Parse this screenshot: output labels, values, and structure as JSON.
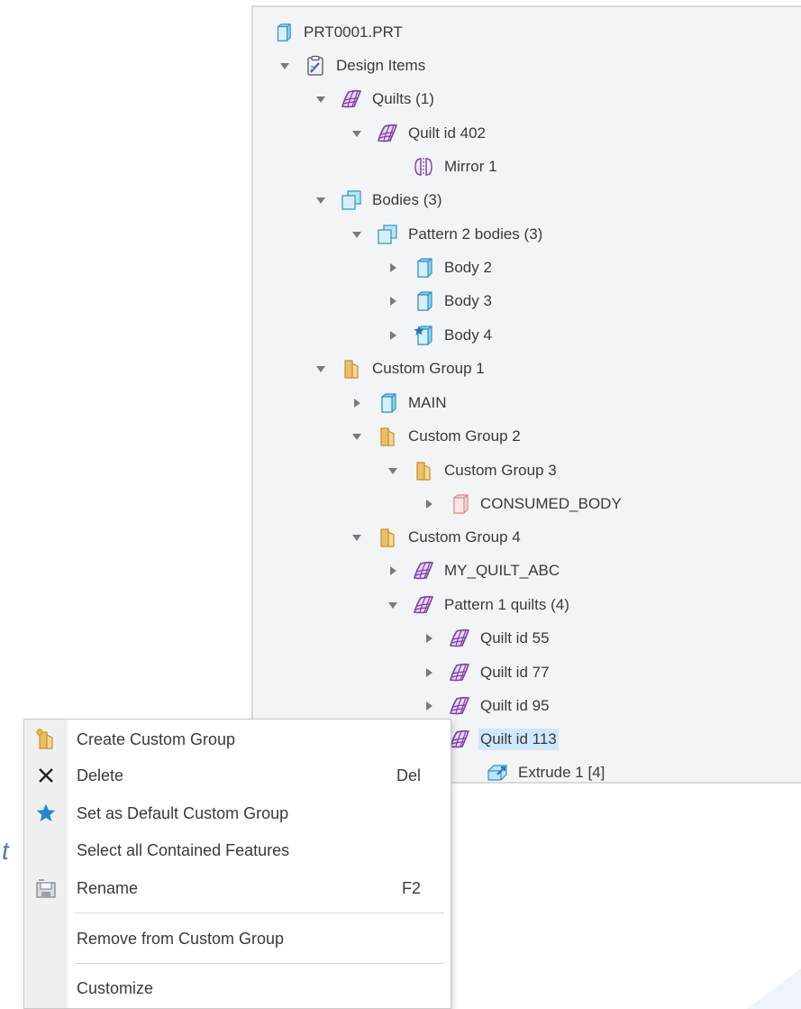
{
  "tree": {
    "root": "PRT0001.PRT",
    "design_items": "Design Items",
    "quilts": "Quilts (1)",
    "quilt_402": "Quilt id 402",
    "mirror": "Mirror 1",
    "bodies": "Bodies (3)",
    "pattern2": "Pattern 2 bodies (3)",
    "body2": "Body 2",
    "body3": "Body 3",
    "body4": "Body 4",
    "cg1": "Custom Group 1",
    "main": "MAIN",
    "cg2": "Custom Group 2",
    "cg3": "Custom Group 3",
    "consumed": "CONSUMED_BODY",
    "cg4": "Custom Group 4",
    "my_quilt": "MY_QUILT_ABC",
    "pattern1": "Pattern 1 quilts (4)",
    "q55": "Quilt id 55",
    "q77": "Quilt id 77",
    "q95": "Quilt id 95",
    "q113": "Quilt id 113",
    "extrude": "Extrude 1 [4]"
  },
  "menu": {
    "create_group": "Create Custom Group",
    "delete": "Delete",
    "delete_sc": "Del",
    "set_default": "Set as Default Custom Group",
    "select_all": "Select all Contained Features",
    "rename": "Rename",
    "rename_sc": "F2",
    "remove": "Remove from Custom Group",
    "customize": "Customize"
  },
  "stray_text": "t",
  "colors": {
    "tree_bg": "#f3f4f5",
    "selection": "#cfe8fb",
    "quilt_purple": "#7b3fa8",
    "body_blue": "#36a9d8",
    "folder_gold": "#d9a43a",
    "consumed_pink": "#e6a3a3"
  },
  "icons": {
    "part": "part-icon",
    "design_items": "clipboard-icon",
    "quilt": "quilt-icon",
    "mirror": "mirror-icon",
    "bodies": "bodies-icon",
    "body": "body-icon",
    "default_body": "body-star-icon",
    "group": "custom-group-icon",
    "consumed": "consumed-body-icon",
    "extrude": "extrude-icon",
    "expand": "expand-arrow-icon",
    "collapse": "collapse-arrow-icon"
  }
}
